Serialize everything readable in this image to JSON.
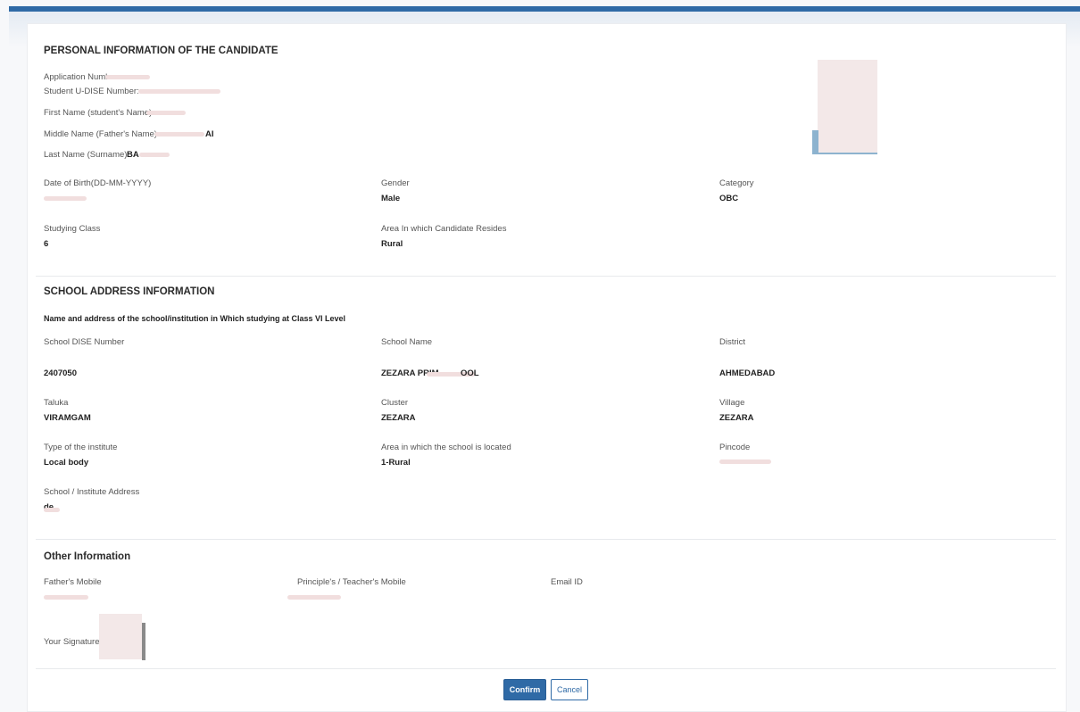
{
  "personal": {
    "title": "PERSONAL INFORMATION OF THE CANDIDATE",
    "application_number_label": "Application Number",
    "udise_label": "Student U-DISE Number:",
    "first_name_label": "First Name (student's Name):",
    "middle_name_label": "Middle Name (Father's Name):",
    "middle_name_suffix": "AI",
    "last_name_label": "Last Name (Surname):",
    "last_name_prefix": "BA",
    "dob_label": "Date of Birth(DD-MM-YYYY)",
    "gender_label": "Gender",
    "gender_value": "Male",
    "category_label": "Category",
    "category_value": "OBC",
    "class_label": "Studying Class",
    "class_value": "6",
    "area_label": "Area In which Candidate Resides",
    "area_value": "Rural"
  },
  "school": {
    "title": "SCHOOL ADDRESS INFORMATION",
    "subtitle": "Name and address of the school/institution in Which studying at Class VI Level",
    "dise_label": "School DISE Number",
    "dise_value": "2407050",
    "name_label": "School Name",
    "name_value": "ZEZARA PRIM",
    "name_value_end": "OOL",
    "district_label": "District",
    "district_value": "AHMEDABAD",
    "taluka_label": "Taluka",
    "taluka_value": "VIRAMGAM",
    "cluster_label": "Cluster",
    "cluster_value": "ZEZARA",
    "village_label": "Village",
    "village_value": "ZEZARA",
    "institute_type_label": "Type of the institute",
    "institute_type_value": "Local body",
    "school_area_label": "Area in which the school is located",
    "school_area_value": "1-Rural",
    "pincode_label": "Pincode",
    "address_label": "School / Institute Address",
    "address_value": "de"
  },
  "other": {
    "title": "Other Information",
    "father_mobile_label": "Father's Mobile",
    "teacher_mobile_label": "Principle's / Teacher's Mobile",
    "email_label": "Email ID",
    "signature_label": "Your Signature"
  },
  "actions": {
    "confirm_label": "Confirm",
    "cancel_label": "Cancel"
  }
}
